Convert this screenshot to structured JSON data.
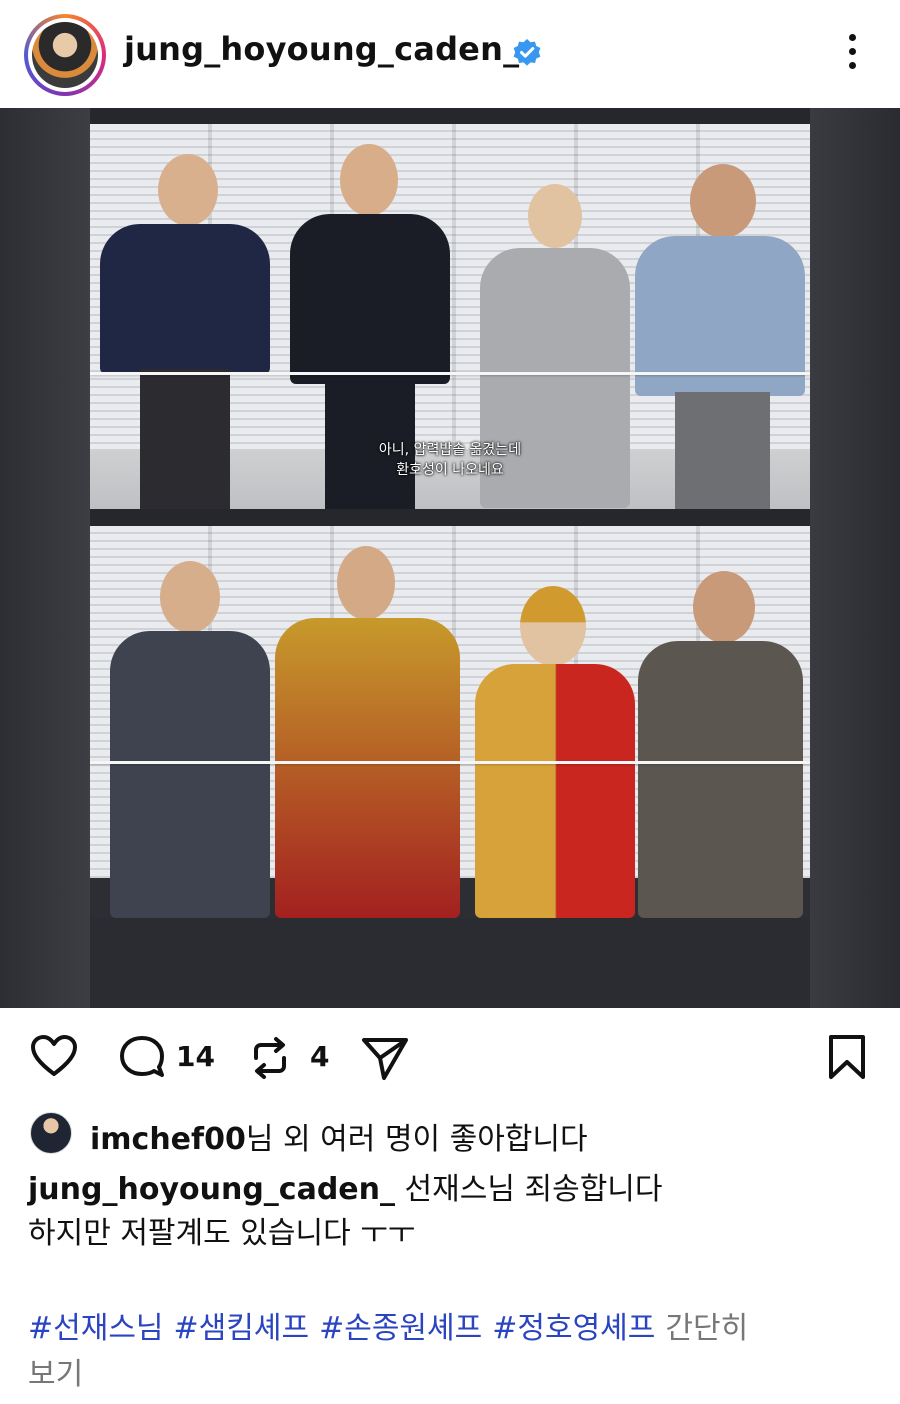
{
  "header": {
    "username": "jung_hoyoung_caden_",
    "verified": true,
    "more_icon": "more-vertical-icon"
  },
  "media": {
    "subtitle_line1": "아니, 압력밥솥 옮겼는데",
    "subtitle_line2": "환호성이 나오네요"
  },
  "actions": {
    "comment_count": "14",
    "repost_count": "4"
  },
  "likes": {
    "user": "imchef00",
    "suffix": "님 외 여러 명이 좋아합니다"
  },
  "caption": {
    "username": "jung_hoyoung_caden_",
    "text_line1": " 선재스님 죄송합니다",
    "text_line2": "하지만 저팔계도 있습니다 ㅜㅜ"
  },
  "hashtags": [
    "#선재스님",
    "#샘킴셰프",
    "#손종원셰프",
    "#정호영셰프"
  ],
  "more_label_1": "간단히",
  "more_label_2": "보기",
  "colors": {
    "hashtag": "#2b44c0",
    "verified": "#3897f0",
    "more_text": "#777777"
  }
}
